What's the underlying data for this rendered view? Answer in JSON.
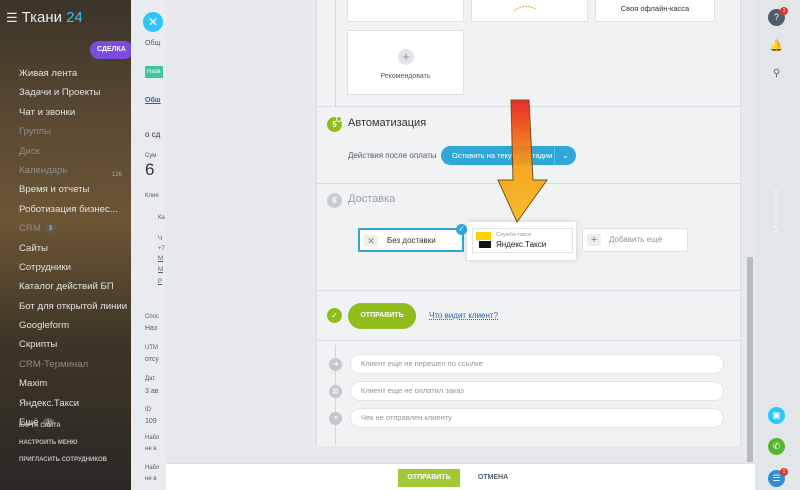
{
  "sidebar": {
    "brand": "Ткани",
    "brand_num": "24",
    "items": [
      {
        "label": "Живая лента",
        "dim": false
      },
      {
        "label": "Задачи и Проекты",
        "dim": false
      },
      {
        "label": "Чат и звонки",
        "dim": false
      },
      {
        "label": "Группы",
        "dim": true
      },
      {
        "label": "Диск",
        "dim": true
      },
      {
        "label": "Календарь",
        "dim": true
      },
      {
        "label": "Время и отчеты",
        "dim": false
      },
      {
        "label": "Роботизация бизнес...",
        "dim": false
      },
      {
        "label": "CRM",
        "dim": true,
        "count": "3"
      },
      {
        "label": "Сайты",
        "dim": false
      },
      {
        "label": "Сотрудники",
        "dim": false
      },
      {
        "label": "Каталог действий БП",
        "dim": false
      },
      {
        "label": "Бот для открытой линии",
        "dim": false
      },
      {
        "label": "Googleform",
        "dim": false
      },
      {
        "label": "Скрипты",
        "dim": false
      },
      {
        "label": "CRM-Терминал",
        "dim": true
      },
      {
        "label": "Maxim",
        "dim": false
      },
      {
        "label": "Яндекс.Такси",
        "dim": false
      },
      {
        "label": "Ещё",
        "dim": false,
        "count": "1"
      }
    ],
    "footer": [
      "КАРТА САЙТА",
      "НАСТРОИТЬ МЕНЮ",
      "ПРИГЛАСИТЬ СОТРУДНИКОВ"
    ]
  },
  "behind": {
    "deal_button": "СДЕЛКА",
    "frag_general": "Общ",
    "frag_nazv": "Назв",
    "frag_tab": "Обш",
    "frag_osd": "о сд",
    "frag_sum": "Сум",
    "frag_6": "6",
    "frag_kli": "Клие",
    "frag_ka": "Ка",
    "frag_ch": "Ч",
    "frag_plus7": "+7",
    "frag_m1": "M",
    "frag_m2": "M",
    "frag_r": "Р",
    "frag_spo": "Спос",
    "frag_naz": "Наз",
    "frag_utm": "UTM",
    "frag_ots": "отсу",
    "frag_dat": "Дат",
    "frag_3a": "3 ав",
    "frag_id": "ID",
    "frag_109": "109",
    "frag_nab": "Набл",
    "frag_ne1": "не в",
    "frag_nab2": "Набл",
    "frag_ne2": "не в",
    "frag_126": "126"
  },
  "payment_tiles": {
    "own_cash": "Своя офлайн-касса",
    "recommend": "Рекомендовать"
  },
  "automation": {
    "step": "5",
    "title": "Автоматизация",
    "after_pay_label": "Действия после оплаты",
    "after_pay_value": "Оставить на текущей стадии"
  },
  "delivery": {
    "step": "6",
    "title": "Доставка",
    "no_delivery": "Без доставки",
    "taxi_service": "Служба такси",
    "taxi_name": "Яндекс.Такси",
    "add_more": "Добавить ещё"
  },
  "send": {
    "button": "ОТПРАВИТЬ",
    "who_sees": "Что видит клиент?"
  },
  "timeline": [
    {
      "icon": "arrow-icon",
      "text": "Клиент еще не перешел по ссылке"
    },
    {
      "icon": "wallet-icon",
      "text": "Клиент еще не оплатил заказ"
    },
    {
      "icon": "receipt-icon",
      "text": "Чек не отправлен клиенту"
    }
  ],
  "bottom": {
    "send": "ОТПРАВИТЬ",
    "cancel": "ОТМЕНА"
  },
  "rail": {
    "help_badge": "1",
    "chat_badge": "1",
    "vertical_text": "БИТРИКС24"
  },
  "colors": {
    "accent_blue": "#2fa8d8",
    "send_green": "#8fbd1e",
    "yandex_yellow": "#ffd200"
  }
}
